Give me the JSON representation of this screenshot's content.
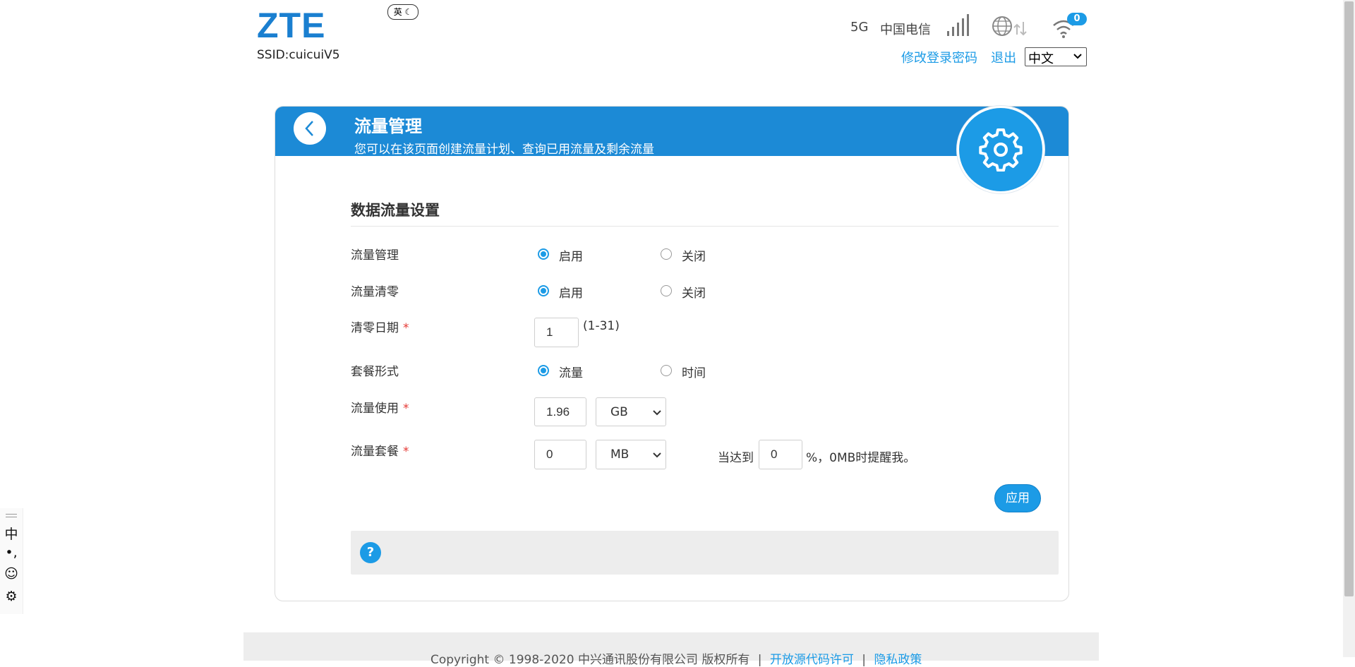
{
  "header": {
    "logo": "ZTE",
    "ime_badge": "英 ☾",
    "ssid": "SSID:cuicuiV5",
    "network_type": "5G",
    "operator": "中国电信",
    "wifi_clients": "0",
    "change_password": "修改登录密码",
    "logout": "退出",
    "language": "中文"
  },
  "panel": {
    "title": "流量管理",
    "subtitle": "您可以在该页面创建流量计划、查询已用流量及剩余流量"
  },
  "form": {
    "section_title": "数据流量设置",
    "traffic_mgmt": {
      "label": "流量管理",
      "opt_on": "启用",
      "opt_off": "关闭",
      "selected": "启用"
    },
    "traffic_reset": {
      "label": "流量清零",
      "opt_on": "启用",
      "opt_off": "关闭",
      "selected": "启用"
    },
    "reset_date": {
      "label": "清零日期",
      "required": "*",
      "value": "1",
      "range": "(1-31)"
    },
    "plan_type": {
      "label": "套餐形式",
      "opt_a": "流量",
      "opt_b": "时间",
      "selected": "流量"
    },
    "used": {
      "label": "流量使用",
      "required": "*",
      "value": "1.96",
      "unit": "GB"
    },
    "plan": {
      "label": "流量套餐",
      "required": "*",
      "value": "0",
      "unit": "MB",
      "alert_prefix": "当达到",
      "alert_value": "0",
      "alert_suffix": "%，0MB时提醒我。"
    },
    "apply": "应用"
  },
  "help": {
    "icon": "?"
  },
  "footer": {
    "copyright": "Copyright © 1998-2020 中兴通讯股份有限公司 版权所有",
    "sep1": "|",
    "open_source": "开放源代码许可",
    "sep2": "|",
    "privacy": "隐私政策"
  },
  "ime_toolbar": {
    "mode": "中",
    "punct": "•,",
    "emoji": "☺",
    "settings": "⚙"
  },
  "colors": {
    "accent": "#1c9be6",
    "header_band": "#1c8ad6",
    "required": "#e53935"
  }
}
